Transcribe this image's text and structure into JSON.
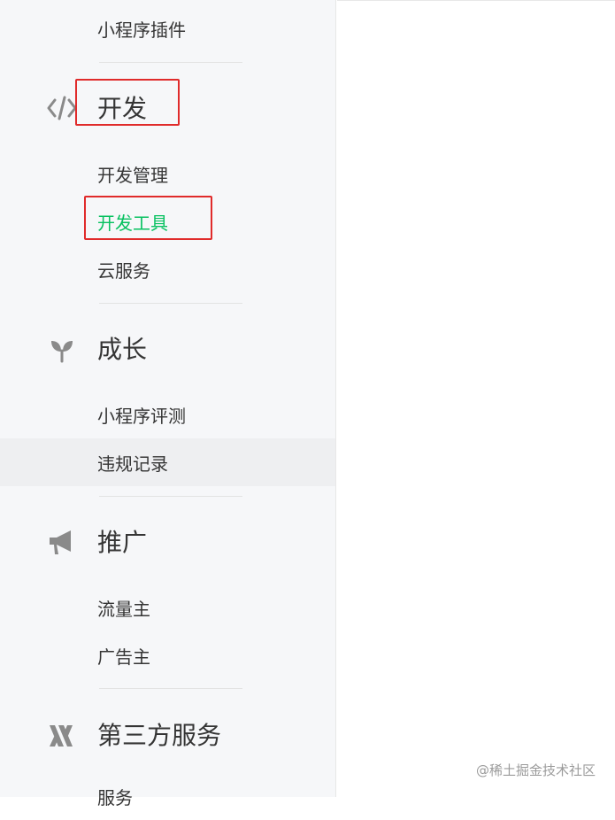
{
  "sidebar": {
    "top_item": "小程序插件",
    "groups": [
      {
        "title": "开发",
        "icon": "code-icon",
        "items": [
          {
            "label": "开发管理"
          },
          {
            "label": "开发工具",
            "active": true
          },
          {
            "label": "云服务"
          }
        ]
      },
      {
        "title": "成长",
        "icon": "sprout-icon",
        "items": [
          {
            "label": "小程序评测"
          },
          {
            "label": "违规记录",
            "hovered": true
          }
        ]
      },
      {
        "title": "推广",
        "icon": "megaphone-icon",
        "items": [
          {
            "label": "流量主"
          },
          {
            "label": "广告主"
          }
        ]
      },
      {
        "title": "第三方服务",
        "icon": "third-party-icon",
        "items": [
          {
            "label": "服务"
          }
        ]
      }
    ]
  },
  "watermark": "@稀土掘金技术社区",
  "colors": {
    "sidebar_bg": "#f6f7f9",
    "active_text": "#07c160",
    "highlight_box": "#e02b2b",
    "text": "#353535",
    "icon": "#8a8a8a"
  }
}
